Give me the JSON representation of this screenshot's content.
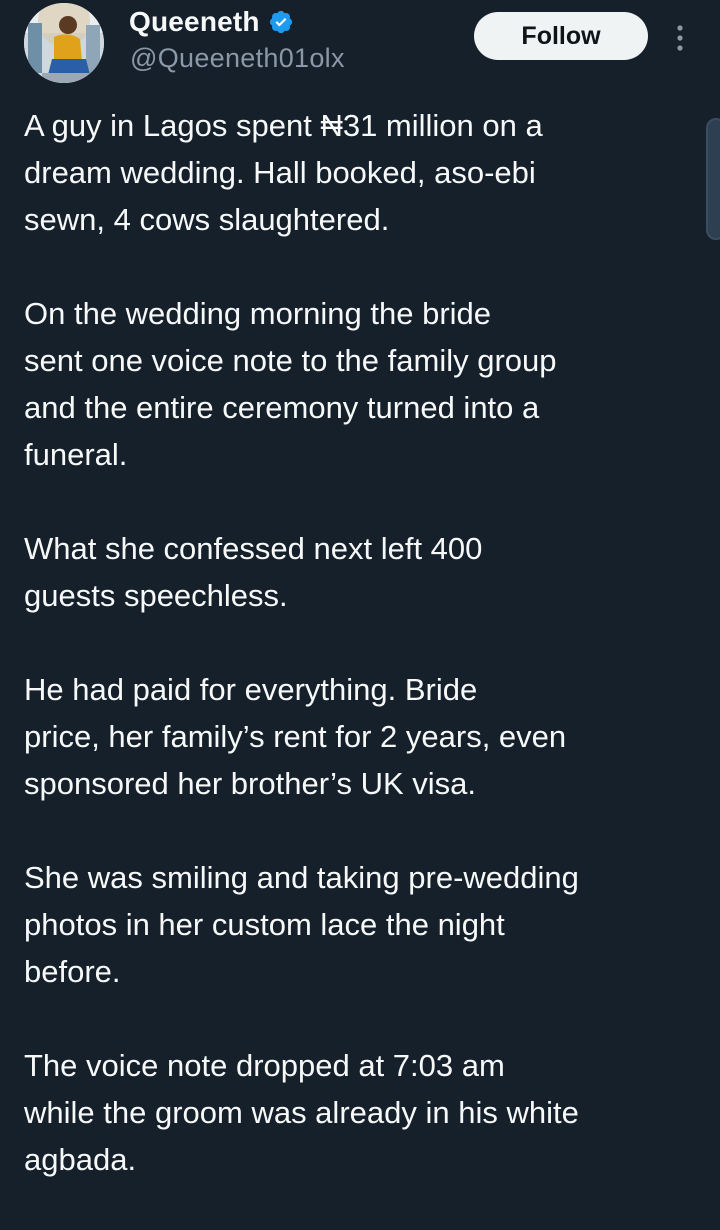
{
  "author": {
    "display_name": "Queeneth",
    "handle": "@Queeneth01olx",
    "verified_icon": "verified-badge-icon",
    "avatar_icon": "avatar"
  },
  "actions": {
    "follow_label": "Follow",
    "more_icon": "more-vertical-icon"
  },
  "colors": {
    "background": "#15202b",
    "text_primary": "#f7f9f9",
    "text_secondary": "#8b98a5",
    "verified": "#1d9bf0",
    "follow_bg": "#eff3f4"
  },
  "tweet": {
    "paragraphs": [
      "A guy in Lagos spent ₦31 million on a\ndream wedding. Hall booked, aso-ebi\nsewn, 4 cows slaughtered.",
      "On the wedding morning the bride\nsent one voice note to the family group\nand the entire ceremony turned into a\nfuneral.",
      "What she confessed next left 400\nguests speechless.",
      "He had paid for everything. Bride\nprice, her family’s rent for 2 years, even\nsponsored her brother’s UK visa.",
      "She was smiling and taking pre-wedding\nphotos in her custom lace the night\nbefore.",
      "The voice note dropped at 7:03 am\nwhile the groom was already in his white\nagbada."
    ]
  }
}
